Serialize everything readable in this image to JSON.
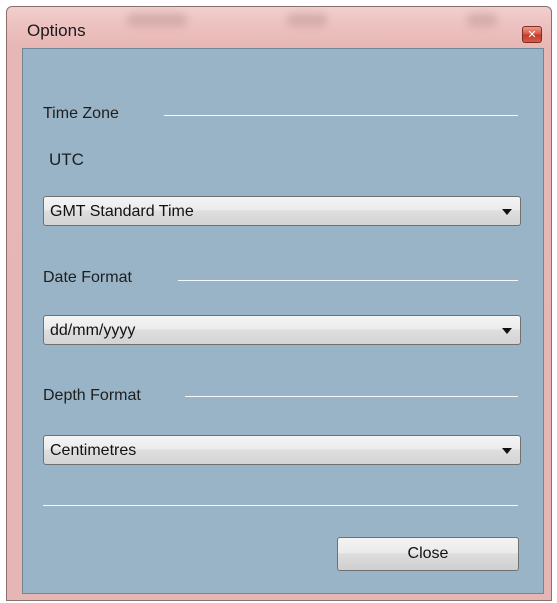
{
  "window": {
    "title": "Options",
    "close_glyph": "✕"
  },
  "time_zone": {
    "label": "Time Zone",
    "current": "UTC",
    "selected": "GMT Standard Time"
  },
  "date_format": {
    "label": "Date Format",
    "selected": "dd/mm/yyyy"
  },
  "depth_format": {
    "label": "Depth Format",
    "selected": "Centimetres"
  },
  "buttons": {
    "close_label": "Close"
  },
  "icons": {
    "window_close": "close-icon",
    "dropdown": "chevron-down-icon"
  },
  "colors": {
    "client_background": "#99b4c6",
    "window_frame": "#e7b7b5",
    "close_button_red": "#c33a26"
  }
}
